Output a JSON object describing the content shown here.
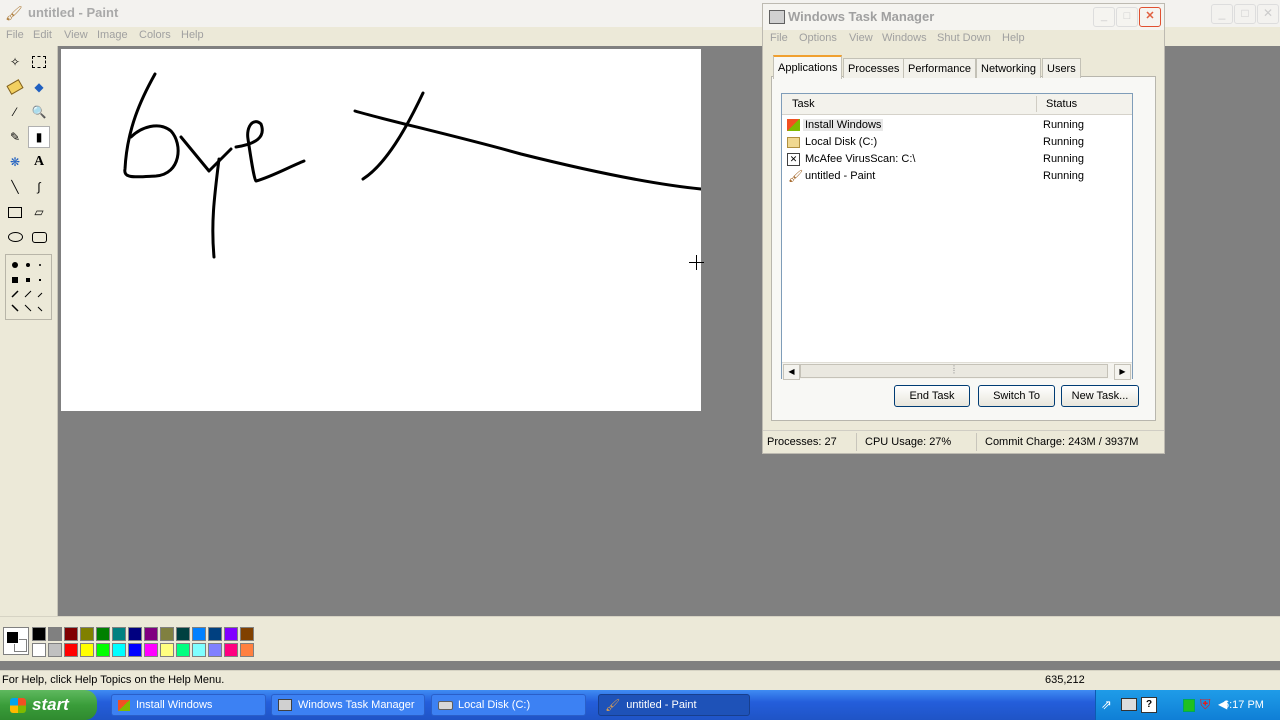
{
  "paint": {
    "title": "untitled - Paint",
    "menu": [
      "File",
      "Edit",
      "View",
      "Image",
      "Colors",
      "Help"
    ],
    "status_help": "For Help, click Help Topics on the Help Menu.",
    "status_coords": "635,212",
    "palette_top": [
      "#000000",
      "#808080",
      "#800000",
      "#808000",
      "#008000",
      "#008080",
      "#000080",
      "#800080",
      "#808040",
      "#004040",
      "#0080ff",
      "#004080",
      "#8000ff",
      "#804000"
    ],
    "palette_bottom": [
      "#ffffff",
      "#c0c0c0",
      "#ff0000",
      "#ffff00",
      "#00ff00",
      "#00ffff",
      "#0000ff",
      "#ff00ff",
      "#ffff80",
      "#00ff80",
      "#80ffff",
      "#8080ff",
      "#ff0080",
      "#ff8040"
    ]
  },
  "taskmgr": {
    "title": "Windows Task Manager",
    "menu": [
      "File",
      "Options",
      "View",
      "Windows",
      "Shut Down",
      "Help"
    ],
    "tabs": [
      "Applications",
      "Processes",
      "Performance",
      "Networking",
      "Users"
    ],
    "columns": {
      "task": "Task",
      "status": "Status"
    },
    "rows": [
      {
        "task": "Install Windows",
        "status": "Running"
      },
      {
        "task": "Local Disk (C:)",
        "status": "Running"
      },
      {
        "task": "McAfee VirusScan: C:\\",
        "status": "Running"
      },
      {
        "task": "untitled - Paint",
        "status": "Running"
      }
    ],
    "buttons": {
      "end_task": "End Task",
      "switch_to": "Switch To",
      "new_task": "New Task..."
    },
    "status": {
      "processes": "Processes: 27",
      "cpu": "CPU Usage: 27%",
      "commit": "Commit Charge: 243M / 3937M"
    }
  },
  "taskbar": {
    "start_label": "start",
    "buttons": [
      "Install Windows",
      "Windows Task Manager",
      "Local Disk (C:)",
      "untitled - Paint"
    ],
    "clock": "6:17 PM"
  }
}
